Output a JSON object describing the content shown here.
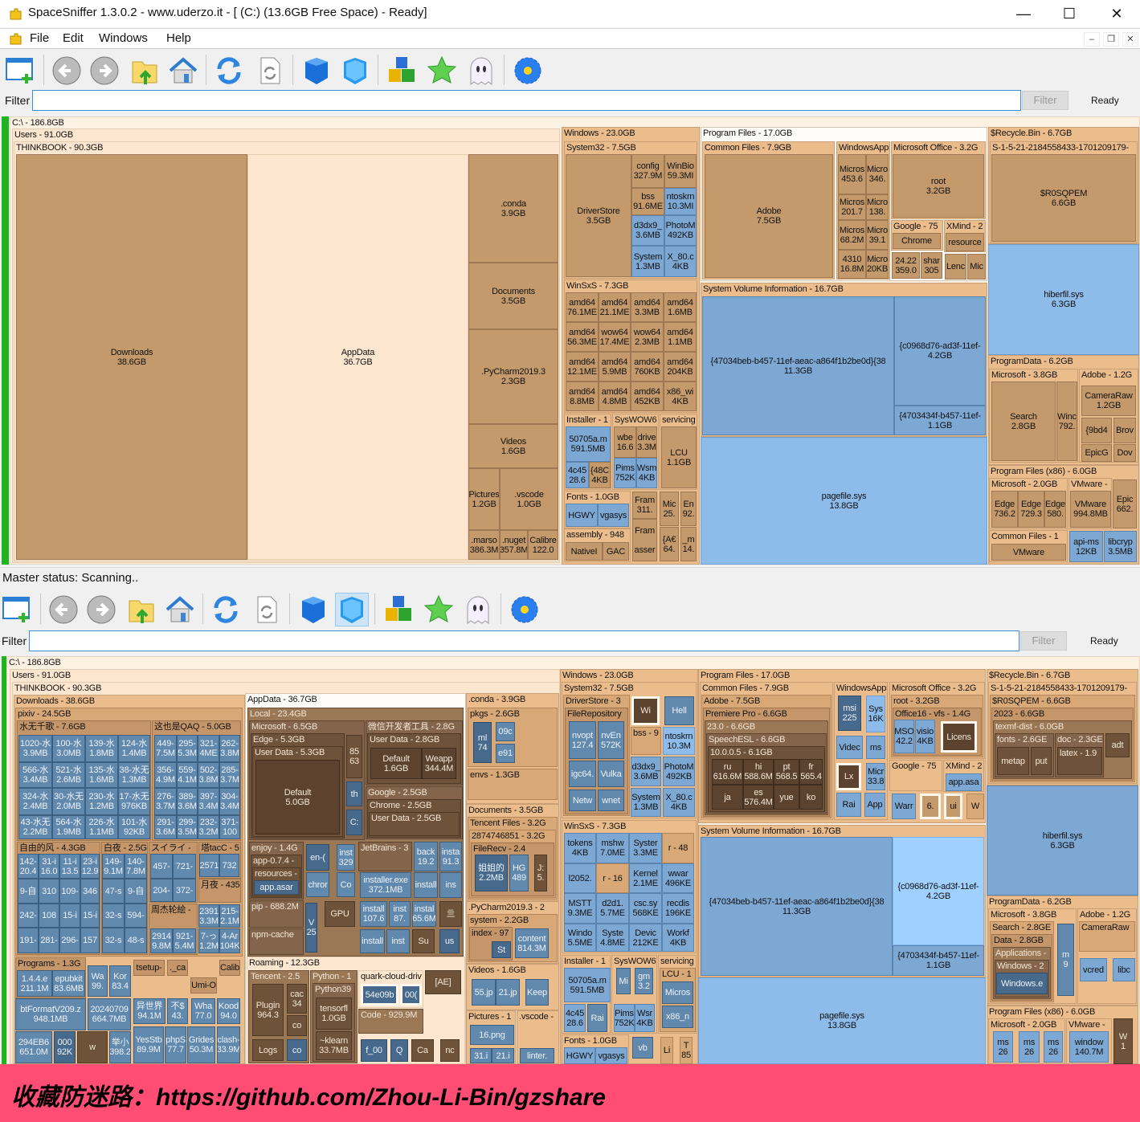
{
  "window": {
    "title": "SpaceSniffer 1.3.0.2 - www.uderzo.it - [ (C:) (13.6GB Free Space) - Ready]",
    "minimize": "—",
    "maximize": "☐",
    "close": "✕"
  },
  "menu": {
    "items": [
      "File",
      "Edit",
      "Windows",
      "Help"
    ],
    "mdi_min": "–",
    "mdi_restore": "❐",
    "mdi_close": "✕"
  },
  "toolbar": {
    "icons": [
      "new-window-icon",
      "back-icon",
      "forward-icon",
      "folder-up-icon",
      "home-icon",
      "refresh-icon",
      "refresh-document-icon",
      "blue-cube-icon",
      "light-blue-cube-icon",
      "cubes-icon",
      "green-star-icon",
      "ghost-icon",
      "blue-flower-icon"
    ]
  },
  "filter": {
    "label": "Filter",
    "value": "",
    "button": "Filter",
    "status": "Ready"
  },
  "status_bar": {
    "text": "Master status: Scanning.."
  },
  "banner": {
    "text": "收藏防迷路：https://github.com/Zhou-Li-Bin/gzshare"
  },
  "colors": {
    "folder_header": "#ecbd8c",
    "folder": "#c49a6c",
    "file": "#7ea8d4",
    "scan_bar": "#1fb31f",
    "banner": "#ff4d73"
  },
  "top_map": {
    "nodes": [
      "C:\\ - 186.8GB",
      "Users - 91.0GB",
      "THINKBOOK - 90.3GB",
      "Downloads\n38.6GB",
      "AppData\n36.7GB",
      ".conda\n3.9GB",
      "Documents\n3.5GB",
      ".PyCharm2019.3\n2.3GB",
      "Videos\n1.6GB",
      "Pictures\n1.2GB",
      ".vscode\n1.0GB",
      ".marso\n386.3M",
      ".nuget\n357.8M",
      "Calibre\n122.0",
      "Windows - 23.0GB",
      "System32 - 7.5GB",
      "DriverStore\n3.5GB",
      "config\n327.9M",
      "WinBio\n59.3MI",
      "bss\n91.6ME",
      "ntoskrn\n10.3MI",
      "d3dx9_\n3.6MB",
      "PhotoM\n492KB",
      "System\n1.3MB",
      "X_80.c\n4KB",
      "WinSxS - 7.3GB",
      "amd64\n76.1ME",
      "amd64\n21.1ME",
      "amd64\n3.3MB",
      "amd64\n1.6MB",
      "amd64\n56.3ME",
      "wow64\n17.4ME",
      "wow64\n2.3MB",
      "amd64\n1.1MB",
      "amd64\n12.1ME",
      "amd64\n5.9MB",
      "amd64\n760KB",
      "amd64\n204KB",
      "amd64\n8.8MB",
      "amd64\n4.8MB",
      "amd64\n452KB",
      "x86_wi\n4KB",
      "Installer - 1",
      "50705a.m\n591.5MB",
      "4c45\n28.6",
      "{48C\n4KB",
      "SysWOW6",
      "wbe\n16.6",
      "drive\n3.3M",
      "Pims\n752K",
      "Wsm\n4KB",
      "servicing",
      "LCU\n1.1GB",
      "Fonts - 1.0GB",
      "HGWY",
      "vgasys",
      "assembly - 948",
      "NativeI",
      "GAC",
      "Fram\n311.",
      "Fram\n\nasser",
      "Mic\n25.",
      "En\n92.",
      "{A€\n64.",
      "_m\n14.",
      "Program Files - 17.0GB",
      "Common Files - 7.9GB",
      "Adobe\n7.5GB",
      "WindowsApps",
      "Micros\n453.6",
      "Micro\n346.",
      "Micros\n201.7",
      "Micro\n138.",
      "Micros\n68.2M",
      "Micro\n39.1",
      "4310\n16.8M",
      "Micro\n20KB",
      "Microsoft Office - 3.2G",
      "root\n3.2GB",
      "Google - 75",
      "Chrome",
      "XMind - 2",
      "resource",
      "24.22\n359.0",
      "shar\n305",
      "Lenc",
      "Mic",
      "System Volume Information - 16.7GB",
      "{47034beb-b457-11ef-aeac-a864f1b2be0d}{38\n11.3GB",
      "{c0968d76-ad3f-11ef-\n4.2GB",
      "{4703434f-b457-11ef-\n1.1GB",
      "pagefile.sys\n13.8GB",
      "$Recycle.Bin - 6.7GB",
      "S-1-5-21-2184558433-1701209179-",
      "$R0SQPEM\n6.6GB",
      "hiberfil.sys\n6.3GB",
      "ProgramData - 6.2GB",
      "Microsoft - 3.8GB",
      "Search\n2.8GB",
      "Winc\n792.",
      "Adobe - 1.2G",
      "CameraRaw\n1.2GB",
      "{9bd4",
      "Brov",
      "EpicG",
      "Dov",
      "Program Files (x86) - 6.0GB",
      "Microsoft - 2.0GB",
      "Edge\n736.2",
      "Edge\n729.3",
      "Edge\n580.",
      "VMware -",
      "VMware\n994.8MB",
      "Epic\n662.",
      "Common Files - 1",
      "VMware",
      "api-ms\n12KB",
      "libcryp\n3.5MB"
    ]
  },
  "bottom_map": {
    "nodes": [
      "C:\\ - 186.8GB",
      "Users - 91.0GB",
      "THINKBOOK - 90.3GB",
      "Downloads - 38.6GB",
      "pixiv - 24.5GB",
      "水无千歌 - 7.6GB",
      "1020-水\n3.9MB",
      "100-水\n3.0MB",
      "139-水\n1.8MB",
      "124-水\n1.4MB",
      "566-水\n3.4MB",
      "521-水\n2.6MB",
      "135-水\n1.6MB",
      "38-水无\n1.3MB",
      "324-水\n2.4MB",
      "30-水无\n2.0MB",
      "230-水\n1.2MB",
      "17-水无\n976KB",
      "43-水无\n2.2MB",
      "564-水\n1.9MB",
      "226-水\n1.1MB",
      "101-水\n92KB",
      "这也是QAQ - 5.0GB",
      "449-\n7.5M",
      "295-\n5.3M",
      "321-\n4ME",
      "262-\n3.8M",
      "356-\n4.9M",
      "559-\n4.1M",
      "502-\n3.8M",
      "285-\n3.7M",
      "276-\n3.7M",
      "389-\n3.6M",
      "397-\n3.4M",
      "304-\n3.4M",
      "291-\n3.6M",
      "299-\n3.5M",
      "232-\n3.2M",
      "371-\n100",
      "自由的风 - 4.3GB",
      "142-\n20.4",
      "31-i\n16.0",
      "11-i\n13.5",
      "23-i\n12.9",
      "9-自",
      "310",
      "109-",
      "346",
      "242-",
      "108",
      "15-i",
      "15-i",
      "191-",
      "281-",
      "296-",
      "157",
      "白夜 - 2.5G",
      "149-\n9.1M",
      "140-\n7.8M",
      "47-s",
      "9-自",
      "32-s",
      "594-",
      "32-s",
      "48-s",
      "スイライ -",
      "457-",
      "721-",
      "204-",
      "372-",
      "周杰轮絵 -",
      "2914\n9.8M",
      "921-\n5.4M",
      "塔tacC - 5",
      "2571",
      "732",
      "月夜 - 435",
      "2391\n3.3M",
      "215-\n2.1M",
      "7-っ\n1.2M",
      "4-Ar\n104K",
      "Programs - 1.3G",
      "1.4.4.e\n211.1M",
      "epubkit\n83.6MB",
      "Wa\n99.",
      "Kor\n83.4",
      "tsetup-",
      "._ca",
      "Calib",
      "Umi-O",
      "btFormatV209.z\n948.1MB",
      "20240709\n664.7MB",
      "异世界\n94.1M",
      "不$\n43.",
      "Wha\n77.0",
      "Kood\n94.0",
      "294EB6\n651.0M",
      "000\n92K",
      "w",
      "举小\n398.2",
      "YesStb\n89.9M",
      "phpS\n77.7",
      "Grides\n50.3M",
      "clash-\n33.9M",
      "AppData - 36.7GB",
      "Local - 23.4GB",
      "Microsoft - 6.5GB",
      "Edge - 5.3GB",
      "User Data - 5.3GB",
      "Default\n5.0GB",
      "85\n63",
      "th",
      "C:",
      "微信开发者工具 - 2.8G",
      "User Data - 2.8GB",
      "Default\n1.6GB",
      "Weapp\n344.4M",
      "Google - 2.5GB",
      "Chrome - 2.5GB",
      "User Data - 2.5GB",
      "enjoy - 1.4G",
      "app-0.7.4 -",
      "resources -",
      "app.asar",
      "en-(",
      "inst\n329",
      "chror",
      "Co",
      "JetBrains - 3",
      "installer.exe\n372.1MB",
      "back\n19.2",
      "insta\n91.3",
      "install",
      "ins",
      "pip - 688.2M",
      "npm-cache",
      "V\n25",
      "GPU",
      "install\n107.6",
      "inst\n87.",
      "instal\n65.6M",
      "亖",
      "install",
      "inst",
      "Su",
      "us",
      "Roaming - 12.3GB",
      "Tencent - 2.5",
      "Plugin\n964.3",
      "cac\n34",
      "co",
      "Logs",
      "co",
      "Python - 1",
      "Python39",
      "tensorfl\n1.0GB",
      "~klearn\n33.7MB",
      "quark-cloud-driv",
      "54e09b",
      "00(",
      "[AE]",
      "Code - 929.9M",
      "f_00",
      "Q",
      "Ca",
      "nc",
      ".conda - 3.9GB",
      "pkgs - 2.6GB",
      "ml\n74",
      "09c",
      "e91",
      "envs - 1.3GB",
      "Documents - 3.5GB",
      "Tencent Files - 3.2G",
      "2874746851 - 3.2G",
      "FileRecv - 2.4",
      "姐姐的\n2.2MB",
      "HG\n489",
      "J:\n5.",
      ".PyCharm2019.3 - 2",
      "system - 2.2GB",
      "index - 97",
      "St",
      "content\n814.3M",
      "Videos - 1.6GB",
      "55.jp",
      "21.jp",
      "Keep",
      "Pictures - 1",
      "16.png",
      "31.i",
      "21.i",
      ".vscode -",
      "linter.",
      "Windows - 23.0GB",
      "System32 - 7.5GB",
      "DriverStore - 3",
      "FileRepository",
      "nvopt\n127.4",
      "nvEn\n572K",
      "igc64.",
      "Vulka",
      "Netw",
      "wnet",
      "Wi",
      "Hell",
      "bss - 9",
      "ntoskrn\n10.3M",
      "d3dx9_\n3.6MB",
      "PhotoM\n492KB",
      "System\n1.3MB",
      "X_80.c\n4KB",
      "WinSxS - 7.3GB",
      "tokens\n4KB",
      "mshw\n7.0ME",
      "Syster\n3.3ME",
      "r - 48",
      "l2052.",
      "r - 16",
      "Kernel\n2.1ME",
      "wwar\n496KE",
      "MSTT\n9.3ME",
      "d2d1.\n5.7ME",
      "csc.sy\n568KE",
      "recdis\n196KE",
      "Windo\n5.5ME",
      "Syste\n4.8ME",
      "Devic\n212KE",
      "Workf\n4KB",
      "Installer - 1",
      "50705a.m\n591.5MB",
      "4c45\n28.6",
      "Rai",
      "SysWOW6",
      "Mi",
      "gm\n3.2",
      "Pims\n752K",
      "Wsr\n4KB",
      "servicing",
      "LCU - 1",
      "Micros",
      "x86_n",
      "Fonts - 1.0GB",
      "HGWY",
      "vgasys",
      "vb",
      "Li",
      "T\n85",
      "Program Files - 17.0GB",
      "Common Files - 7.9GB",
      "Adobe - 7.5GB",
      "Premiere Pro - 6.6GB",
      "23.0 - 6.6GB",
      "SpeechESL - 6.6GB",
      "10.0.0.5 - 6.1GB",
      "ru\n616.6M",
      "hi\n588.6M",
      "pt\n568.5",
      "fr\n565.4",
      "ja",
      "es\n576.4M",
      "yue",
      "ko",
      "WindowsApps",
      "msi\n225",
      "Sys\n16K",
      "Videc",
      "ms",
      "Lx",
      "Micr\n33.8",
      "Rai",
      "App",
      "Microsoft Office - 3.2G",
      "root - 3.2GB",
      "Office16 - vfs - 1.4G",
      "MSO\n42.2",
      "visio\n4KB",
      "Licens",
      "Google - 75",
      "XMind - 2",
      "app.asa",
      "Warr",
      "6.",
      "ui",
      "W",
      "System Volume Information - 16.7GB",
      "{47034beb-b457-11ef-aeac-a864f1b2be0d}{38\n11.3GB",
      "{c0968d76-ad3f-11ef-\n4.2GB",
      "{4703434f-b457-11ef-\n1.1GB",
      "pagefile.sys\n13.8GB",
      "$Recycle.Bin - 6.7GB",
      "S-1-5-21-2184558433-1701209179-",
      "$R0SQPEM - 6.6GB",
      "2023 - 6.6GB",
      "texmf-dist - 6.0GB",
      "fonts - 2.6GE",
      "metap",
      "put",
      "doc - 2.3GE",
      "latex - 1.9",
      "adt",
      "hiberfil.sys\n6.3GB",
      "ProgramData - 6.2GB",
      "Microsoft - 3.8GB",
      "Search - 2.8GE",
      "Data - 2.8GB",
      "Applications -",
      "Windows - 2",
      "Windows.e",
      "m\n9",
      "Adobe - 1.2G",
      "CameraRaw",
      "vcred",
      "libc",
      "Program Files (x86) - 6.0GB",
      "Microsoft - 2.0GB",
      "ms\n26",
      "ms\n26",
      "ms\n26",
      "VMware -",
      "window\n140.7M",
      "W\n1"
    ]
  }
}
